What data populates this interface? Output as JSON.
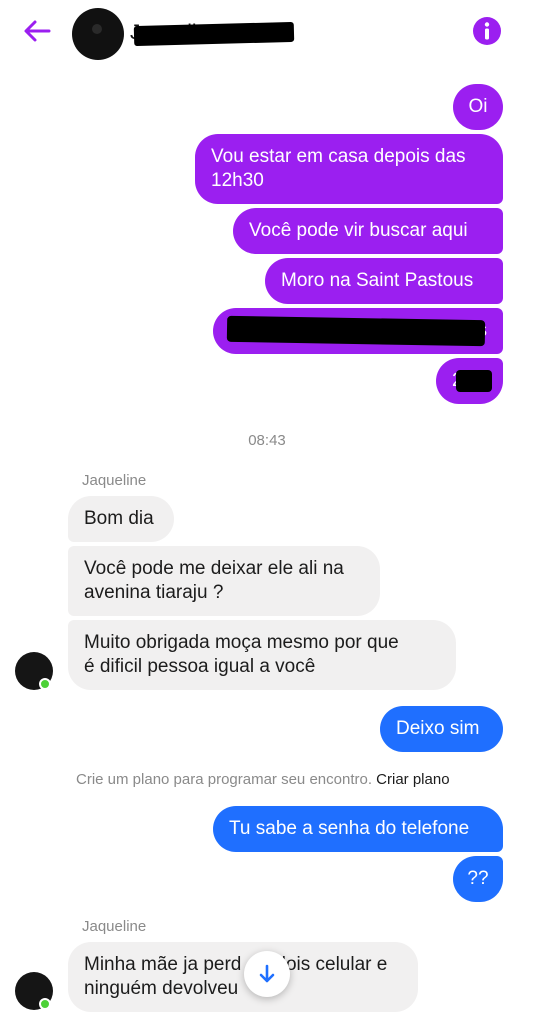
{
  "header": {
    "contact_name": "Jaqueline Celular",
    "back_icon": "arrow-left-icon",
    "info_icon": "info-icon",
    "accent_color": "#9b1ff0"
  },
  "messages_sent_1": [
    "Oi",
    "Vou estar em casa depois das",
    "12h30",
    "Você pode vir buscar aqui",
    "Moro na Saint Pastous",
    "s",
    "2"
  ],
  "timestamp": "08:43",
  "sender_label_1": "Jaqueline",
  "messages_received_1": [
    "Bom dia",
    "Você pode me deixar ele ali na",
    "avenina tiaraju ?",
    "Muito obrigada moça mesmo por que",
    "é dificil pessoa igual a você"
  ],
  "messages_sent_2": [
    "Deixo sim"
  ],
  "plan_prompt": {
    "text": "Crie um plano para programar seu encontro.",
    "link": "Criar plano"
  },
  "messages_sent_3": [
    "Tu sabe a senha do telefone",
    "??"
  ],
  "sender_label_2": "Jaqueline",
  "messages_received_2": [
    "Minha mãe ja perd",
    "dois celular e",
    "ninguém devolveu"
  ],
  "scroll_down_icon": "arrow-down-icon",
  "colors": {
    "outgoing_purple": "#9b1ff0",
    "outgoing_blue": "#1f6fff",
    "incoming_gray": "#f1f0f0",
    "online_green": "#4cd137"
  }
}
